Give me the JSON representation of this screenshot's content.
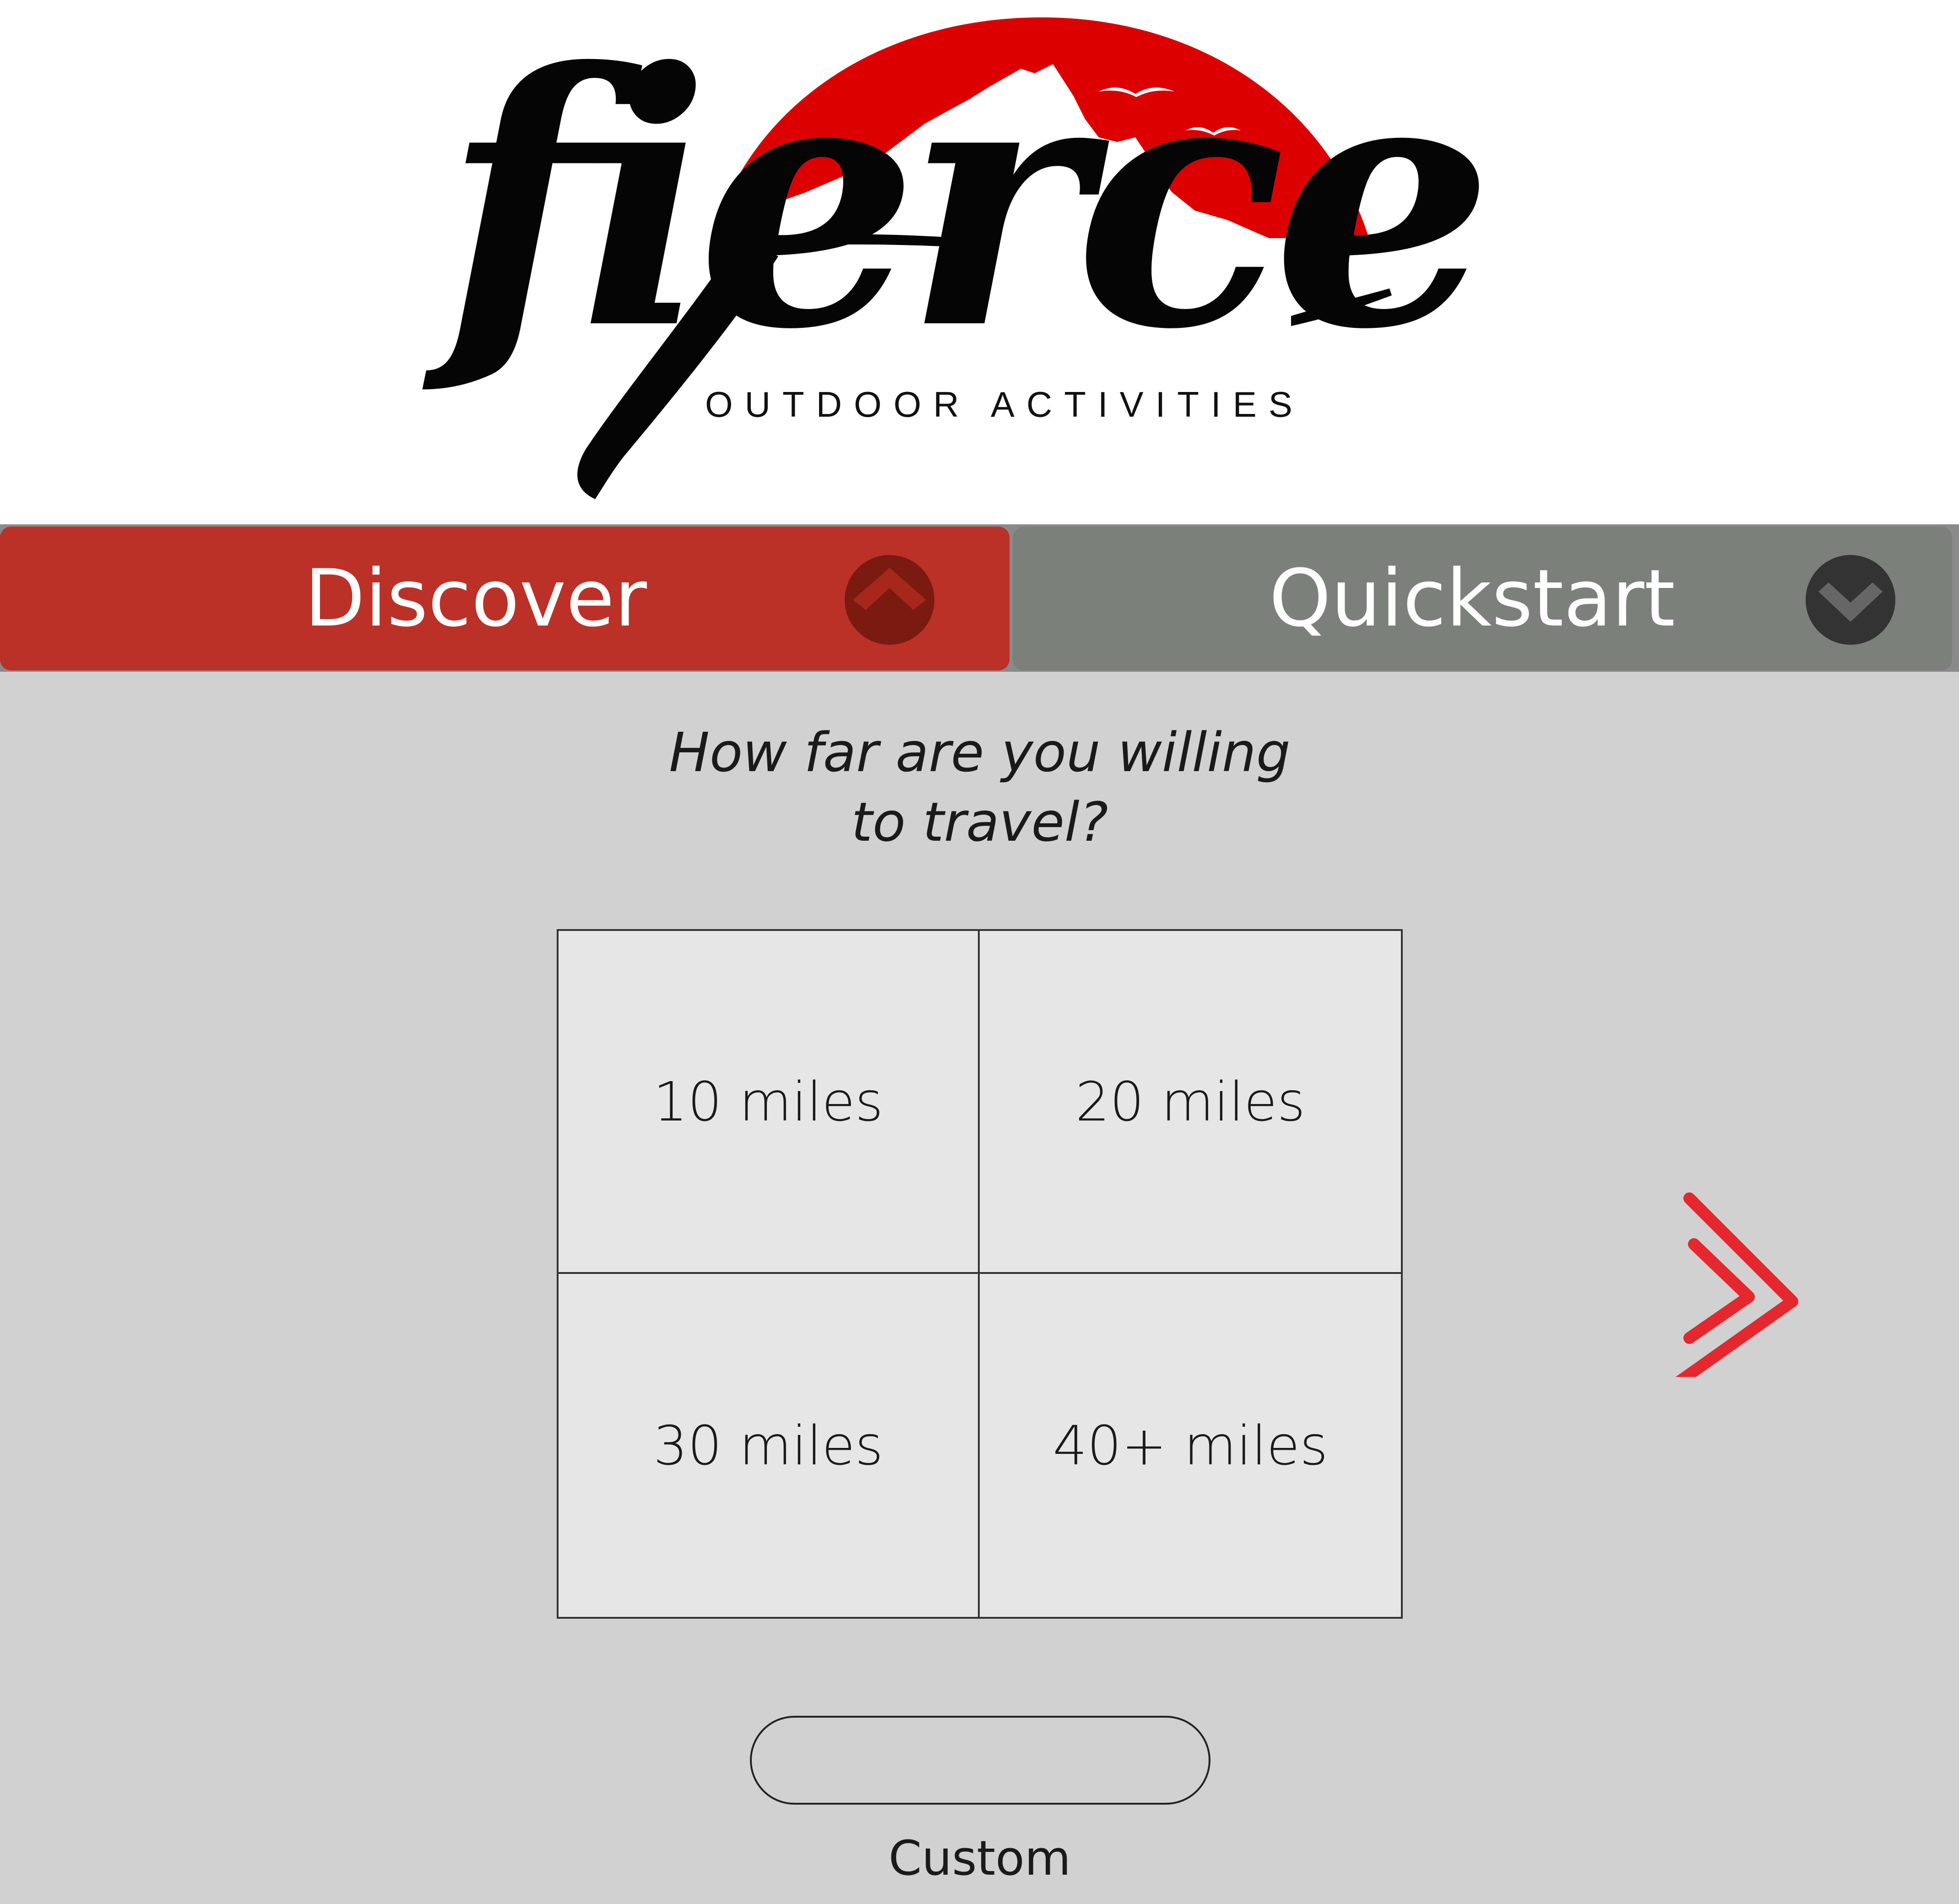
{
  "logo": {
    "wordmark": "fierce",
    "tagline": "OUTDOOR ACTIVITIES",
    "sun_color": "#dd0000",
    "icon": "mountain-sun-logo"
  },
  "tabs": [
    {
      "label": "Discover",
      "state": "expanded",
      "icon": "chevron-up-icon",
      "color": "#bb3127"
    },
    {
      "label": "Quickstart",
      "state": "collapsed",
      "icon": "chevron-down-icon",
      "color": "#7b807b"
    }
  ],
  "main": {
    "question_line1": "How far are you willing",
    "question_line2": "to travel?",
    "options": [
      "10 miles",
      "20 miles",
      "30 miles",
      "40+ miles"
    ],
    "custom": {
      "value": "",
      "placeholder": "",
      "label": "Custom"
    },
    "next_icon": "double-chevron-right-icon",
    "accent_color": "#e6282e"
  }
}
